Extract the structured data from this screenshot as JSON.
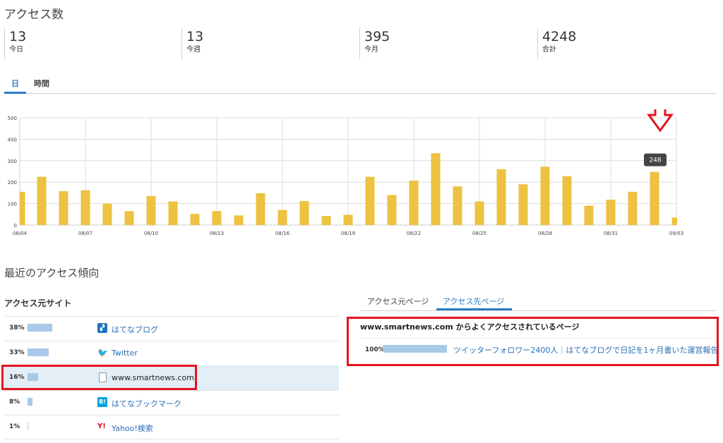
{
  "page": {
    "title": "アクセス数"
  },
  "stats": [
    {
      "value": "13",
      "label": "今日"
    },
    {
      "value": "13",
      "label": "今週"
    },
    {
      "value": "395",
      "label": "今月"
    },
    {
      "value": "4248",
      "label": "合計"
    }
  ],
  "chart_tabs": {
    "day": "日",
    "hour": "時間",
    "active": "day"
  },
  "chart_data": {
    "type": "bar",
    "categories": [
      "08/04",
      "08/05",
      "08/06",
      "08/07",
      "08/08",
      "08/09",
      "08/10",
      "08/11",
      "08/12",
      "08/13",
      "08/14",
      "08/15",
      "08/16",
      "08/17",
      "08/18",
      "08/19",
      "08/20",
      "08/21",
      "08/22",
      "08/23",
      "08/24",
      "08/25",
      "08/26",
      "08/27",
      "08/28",
      "08/29",
      "08/30",
      "08/31",
      "09/01",
      "09/02",
      "09/03"
    ],
    "values": [
      155,
      225,
      158,
      162,
      100,
      65,
      135,
      110,
      52,
      65,
      45,
      148,
      70,
      112,
      42,
      48,
      225,
      140,
      207,
      335,
      180,
      110,
      260,
      190,
      272,
      228,
      90,
      118,
      155,
      248,
      35
    ],
    "tick_labels": [
      "08/04",
      "08/07",
      "08/10",
      "08/13",
      "08/16",
      "08/19",
      "08/22",
      "08/25",
      "08/28",
      "08/31",
      "09/03"
    ],
    "yticks": [
      0,
      100,
      200,
      300,
      400,
      500
    ],
    "ylim": [
      0,
      500
    ],
    "tooltip": "248",
    "bar_color": "#ecc240",
    "grid": true
  },
  "trends": {
    "title": "最近のアクセス傾向"
  },
  "sources": {
    "title": "アクセス元サイト",
    "rows": [
      {
        "pct": "38%",
        "share": 0.38,
        "name": "はてなブログ",
        "icon": "hatena-blog-icon"
      },
      {
        "pct": "33%",
        "share": 0.33,
        "name": "Twitter",
        "icon": "twitter-icon"
      },
      {
        "pct": "16%",
        "share": 0.16,
        "name": "www.smartnews.com",
        "icon": "document-icon"
      },
      {
        "pct": "8%",
        "share": 0.08,
        "name": "はてなブックマーク",
        "icon": "hatena-bookmark-icon"
      },
      {
        "pct": "1%",
        "share": 0.01,
        "name": "Yahoo!検索",
        "icon": "yahoo-icon"
      }
    ]
  },
  "page_tabs": {
    "source": "アクセス元ページ",
    "dest": "アクセス先ページ",
    "active": "dest"
  },
  "dest": {
    "title": "www.smartnews.com からよくアクセスされているページ",
    "rows": [
      {
        "pct": "100%",
        "share": 1.0,
        "link": "ツイッターフォロワー2400人｜はてなブログで日記を1ヶ月書いた運営報告"
      }
    ]
  },
  "colors": {
    "accent": "#2a7fc8",
    "highlight": "#e2141f",
    "bar": "#ecc240",
    "source_bar": "#a9c9e8"
  }
}
